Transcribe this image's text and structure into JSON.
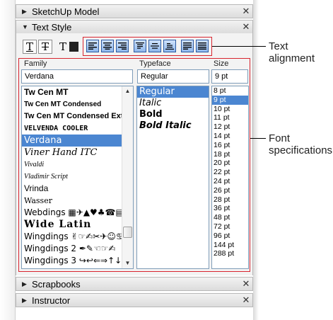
{
  "trays": {
    "sketchup_model": "SketchUp Model",
    "text_style": "Text Style",
    "scrapbooks": "Scrapbooks",
    "instructor": "Instructor",
    "close_glyph": "✕"
  },
  "toolbar": {
    "text_style_buttons": [
      "T",
      "T",
      "T"
    ],
    "alignment_buttons": [
      "align-left",
      "align-center",
      "align-right",
      "align-top",
      "align-middle",
      "align-bottom",
      "justify",
      "justify-all"
    ]
  },
  "font_panel": {
    "family_header": "Family",
    "typeface_header": "Typeface",
    "size_header": "Size",
    "family_value": "Verdana",
    "typeface_value": "Regular",
    "size_value": "9 pt",
    "families": [
      "Tw Cen MT",
      "Tw Cen MT Condensed",
      "Tw Cen MT Condensed Extra Bold",
      "VELVENDA COOLER",
      "Verdana",
      "Viner Hand ITC",
      "Vivaldi",
      "Vladimir Script",
      "Vrinda",
      "Wasser",
      "Webdings",
      "Wide Latin",
      "Wingdings",
      "Wingdings 2",
      "Wingdings 3"
    ],
    "typefaces": [
      "Regular",
      "Italic",
      "Bold",
      "Bold Italic"
    ],
    "sizes": [
      "8 pt",
      "9 pt",
      "10 pt",
      "11 pt",
      "12 pt",
      "14 pt",
      "16 pt",
      "18 pt",
      "20 pt",
      "22 pt",
      "24 pt",
      "26 pt",
      "28 pt",
      "36 pt",
      "48 pt",
      "72 pt",
      "96 pt",
      "144 pt",
      "288 pt"
    ]
  },
  "annotations": {
    "text_alignment_line1": "Text",
    "text_alignment_line2": "alignment",
    "font_spec_line1": "Font",
    "font_spec_line2": "specifications"
  },
  "colors": {
    "selection": "#4b86d1",
    "callout_red": "#d8242f"
  }
}
